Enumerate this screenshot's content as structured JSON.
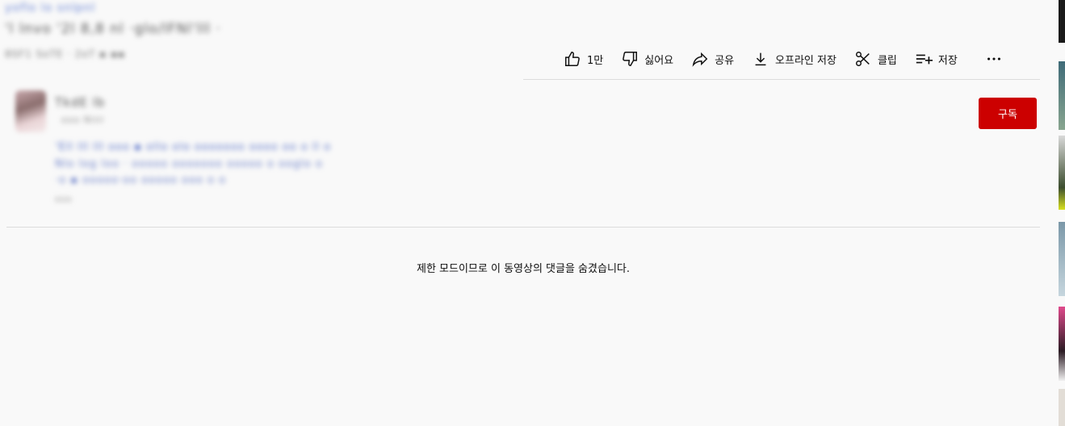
{
  "video": {
    "title_blurred": "yoflo lo snlpnl",
    "subtitle_blurred": "'l lnvo '2l 8,8 nl ·glo/lFNl'lll ·",
    "meta_blurred": "8SF1 SoTE · 2oT ▪ ▪▪"
  },
  "actions": [
    {
      "name": "like",
      "label": "1만",
      "icon": "thumbs-up-icon"
    },
    {
      "name": "dislike",
      "label": "싫어요",
      "icon": "thumbs-down-icon"
    },
    {
      "name": "share",
      "label": "공유",
      "icon": "share-icon"
    },
    {
      "name": "download",
      "label": "오프라인 저장",
      "icon": "download-icon"
    },
    {
      "name": "clip",
      "label": "클립",
      "icon": "scissors-icon"
    },
    {
      "name": "save",
      "label": "저장",
      "icon": "playlist-add-icon"
    },
    {
      "name": "more",
      "label": "",
      "icon": "more-horizontal-icon"
    }
  ],
  "channel": {
    "name_blurred": "TkdE lb",
    "subs_blurred": "ooo Nlnl",
    "subscribe_label": "구독"
  },
  "description": {
    "line1_blurred": "'Ell lll lll ooo ▪ ollo olo ooooooo oooo oo o ll o",
    "line2_blurred": "Nlo log loo · ooooo ooooooo ooooo o ooglo o",
    "line3_blurred": "·o ▪ ooooo·oo ooooo ooo o o",
    "line4_blurred": "ooo"
  },
  "comments": {
    "restricted_message": "제한 모드이므로 이 동영상의 댓글을 숨겼습니다."
  },
  "colors": {
    "subscribe_bg": "#cc0000",
    "page_bg": "#f9f9f9",
    "link_blue": "#3b5bd6"
  }
}
